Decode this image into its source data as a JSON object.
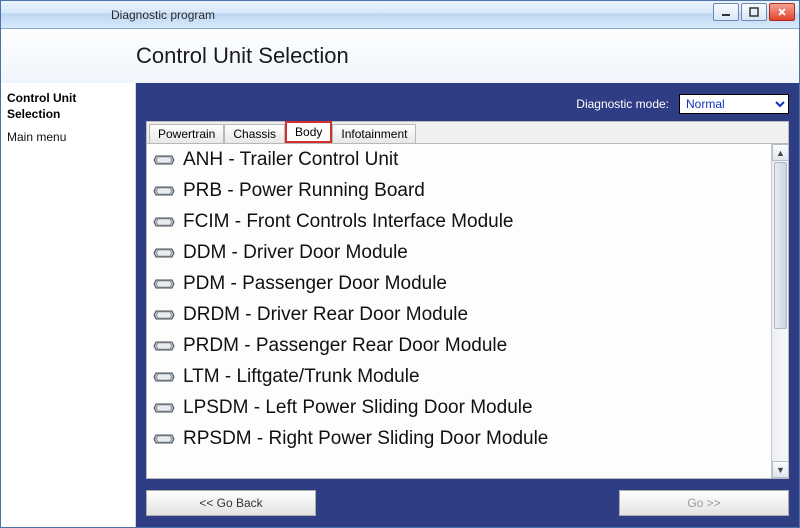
{
  "window": {
    "title": "Diagnostic program"
  },
  "header": {
    "title": "Control Unit Selection"
  },
  "sidebar": {
    "heading": "Control Unit Selection",
    "items": [
      "Main menu"
    ]
  },
  "mode": {
    "label": "Diagnostic mode:",
    "value": "Normal"
  },
  "tabs": [
    {
      "label": "Powertrain",
      "active": false
    },
    {
      "label": "Chassis",
      "active": false
    },
    {
      "label": "Body",
      "active": true
    },
    {
      "label": "Infotainment",
      "active": false
    }
  ],
  "list": [
    "ANH - Trailer Control Unit",
    "PRB - Power Running Board",
    "FCIM - Front Controls Interface Module",
    "DDM - Driver Door Module",
    "PDM - Passenger Door Module",
    "DRDM - Driver Rear Door Module",
    "PRDM - Passenger Rear Door Module",
    "LTM - Liftgate/Trunk Module",
    "LPSDM - Left Power Sliding Door Module",
    "RPSDM - Right Power Sliding Door Module"
  ],
  "footer": {
    "back": "<< Go Back",
    "next": "Go >>"
  }
}
